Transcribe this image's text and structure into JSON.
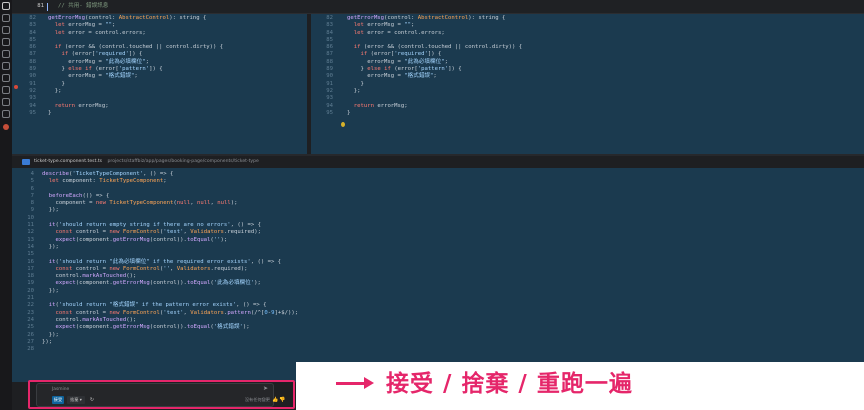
{
  "sticky": {
    "line": "81",
    "text": "// 共用- 錯誤訊息"
  },
  "left_pane": {
    "lines": [
      "82",
      "83",
      "84",
      "85",
      "86",
      "87",
      "88",
      "89",
      "90",
      "91",
      "92",
      "93",
      "94",
      "95"
    ],
    "code": [
      "getErrorMsg(control: AbstractControl): string {",
      "  let errorMsg = \"\";",
      "  let error = control.errors;",
      "",
      "  if (error && (control.touched || control.dirty)) {",
      "    if (error['required']) {",
      "      errorMsg = \"此為必填欄位\";",
      "    } else if (error['pattern']) {",
      "      errorMsg = \"格式錯誤\";",
      "    }",
      "  };",
      "",
      "  return errorMsg;",
      "}"
    ]
  },
  "right_pane": {
    "lines": [
      "82",
      "83",
      "84",
      "85",
      "86",
      "87",
      "88",
      "89",
      "90",
      "91",
      "92",
      "93",
      "94",
      "95"
    ],
    "code": [
      "getErrorMsg(control: AbstractControl): string {",
      "  let errorMsg = \"\";",
      "  let error = control.errors;",
      "",
      "  if (error && (control.touched || control.dirty)) {",
      "    if (error['required']) {",
      "      errorMsg = \"此為必填欄位\";",
      "    } else if (error['pattern']) {",
      "      errorMsg = \"格式錯誤\";",
      "    }",
      "  };",
      "",
      "  return errorMsg;",
      "}"
    ]
  },
  "breadcrumb": {
    "file": "ticket-type.component.test.ts",
    "path": "projects/staffbiz/app/pages/booking-page/components/ticket-type"
  },
  "test_pane": {
    "lines": [
      "4",
      "5",
      "6",
      "7",
      "8",
      "9",
      "10",
      "11",
      "12",
      "13",
      "14",
      "15",
      "16",
      "17",
      "18",
      "19",
      "20",
      "21",
      "22",
      "23",
      "24",
      "25",
      "26",
      "27",
      "28"
    ],
    "code": [
      "describe('TicketTypeComponent', () => {",
      "  let component: TicketTypeComponent;",
      "",
      "  beforeEach(() => {",
      "    component = new TicketTypeComponent(null, null, null);",
      "  });",
      "",
      "  it('should return empty string if there are no errors', () => {",
      "    const control = new FormControl('test', Validators.required);",
      "    expect(component.getErrorMsg(control)).toEqual('');",
      "  });",
      "",
      "  it('should return \"此為必填欄位\" if the required error exists', () => {",
      "    const control = new FormControl('', Validators.required);",
      "    control.markAsTouched();",
      "    expect(component.getErrorMsg(control)).toEqual('此為必填欄位');",
      "  });",
      "",
      "  it('should return \"格式錯誤\" if the pattern error exists', () => {",
      "    const control = new FormControl('test', Validators.pattern(/^[0-9]+$/));",
      "    control.markAsTouched();",
      "    expect(component.getErrorMsg(control)).toEqual('格式錯誤');",
      "  });",
      "});",
      ""
    ]
  },
  "chat": {
    "input_text": "Jasmine",
    "submit_icon": "send-icon",
    "accept_label": "接受",
    "discard_label": "捨棄",
    "rerun_icon": "refresh-icon",
    "status_text": "沒有任何變更",
    "thumbs_up_icon": "thumbs-up-icon",
    "thumbs_down_icon": "thumbs-down-icon"
  },
  "annotation": {
    "text": "接受 / 捨棄 / 重跑一遍"
  },
  "colors": {
    "editor_bg": "#1e1f22",
    "diff_bg": "#1b3a4f",
    "accent": "#e5266a",
    "accept_button": "#0e639c"
  }
}
